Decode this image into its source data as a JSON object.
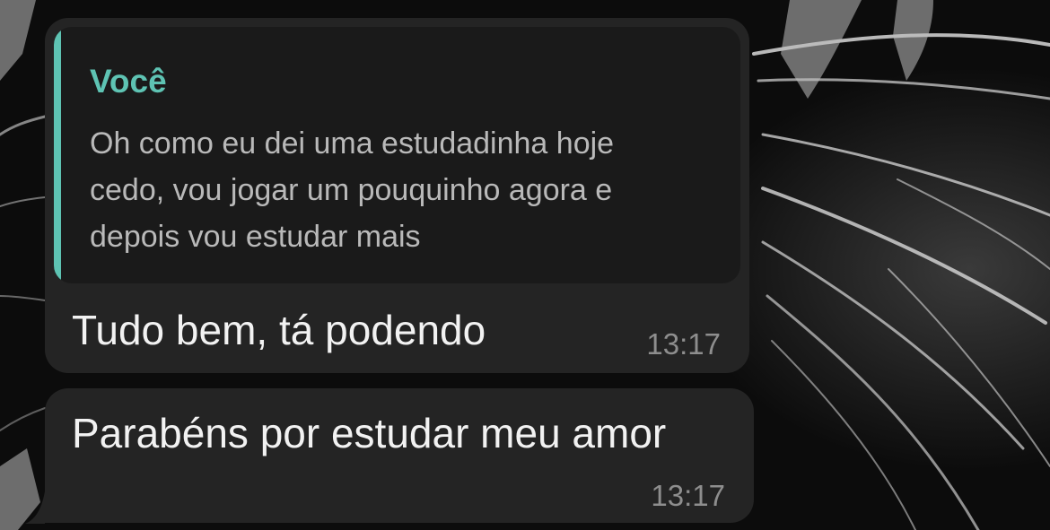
{
  "theme": {
    "bubble_bg": "#242424",
    "quote_bg": "#1a1a1a",
    "accent": "#5ec3b3",
    "text": "#f2f2f2",
    "muted": "#8e8e8e"
  },
  "messages": [
    {
      "reply": {
        "author": "Você",
        "text": "Oh como eu dei uma estudadinha hoje\ncedo, vou jogar um pouquinho agora e\ndepois vou estudar mais"
      },
      "text": "Tudo bem, tá podendo",
      "time": "13:17"
    },
    {
      "text": "Parabéns por estudar meu amor",
      "time": "13:17"
    }
  ]
}
